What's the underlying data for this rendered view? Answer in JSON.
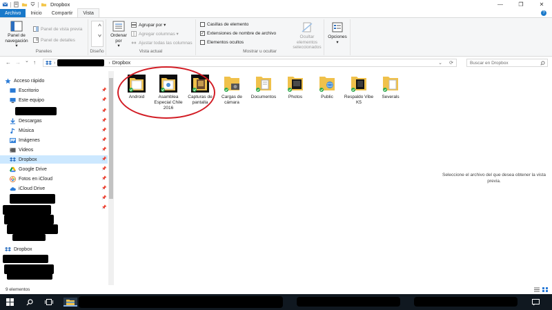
{
  "window": {
    "title": "Dropbox",
    "minimize": "—",
    "maximize": "❐",
    "close": "✕"
  },
  "tabs": [
    "Archivo",
    "Inicio",
    "Compartir",
    "Vista"
  ],
  "ribbon": {
    "help": "?",
    "paneles": {
      "label": "Paneles",
      "nav_pane": "Panel de navegación",
      "nav_pane_arrow": "▾",
      "preview_pane": "Panel de vista previa",
      "details_pane": "Panel de detalles"
    },
    "diseno": {
      "label": "Diseño"
    },
    "vista_actual": {
      "label": "Vista actual",
      "sort": "Ordenar por",
      "sort_arrow": "▾",
      "group": "Agrupar por ▾",
      "add_columns": "Agregar columnas ▾",
      "fit_columns": "Ajustar todas las columnas"
    },
    "mostrar": {
      "label": "Mostrar u ocultar",
      "item_checkboxes": "Casillas de elemento",
      "extensions": "Extensiones de nombre de archivo",
      "hidden_items": "Elementos ocultos",
      "hide_selected": "Ocultar elementos seleccionados",
      "check_mark": "✓"
    },
    "opciones": {
      "label": "Opciones",
      "arrow": "▾"
    }
  },
  "nav": {
    "back": "←",
    "forward": "→",
    "recent": "⌄",
    "up": "↑",
    "address": "Dropbox",
    "address_chevron": "›",
    "dropdown": "⌄",
    "refresh": "⟳",
    "search_placeholder": "Buscar en Dropbox"
  },
  "sidebar": {
    "pin": "📌",
    "items": [
      {
        "label": "Acceso rápido"
      },
      {
        "label": "Escritorio"
      },
      {
        "label": "Este equipo"
      },
      {
        "label": "Descargas"
      },
      {
        "label": "Música"
      },
      {
        "label": "Imágenes"
      },
      {
        "label": "Videos"
      },
      {
        "label": "Dropbox"
      },
      {
        "label": "Google Drive"
      },
      {
        "label": "Fotos en iCloud"
      },
      {
        "label": "iCloud Drive"
      },
      {
        "label": "Dropbox"
      }
    ]
  },
  "folders": [
    {
      "label": "Android"
    },
    {
      "label": "Asamblea Especial Chile 2016"
    },
    {
      "label": "Capturas de pantalla"
    },
    {
      "label": "Cargas de cámara"
    },
    {
      "label": "Documentos"
    },
    {
      "label": "Photos"
    },
    {
      "label": "Public"
    },
    {
      "label": "Respaldo Vibe K5"
    },
    {
      "label": "Severals"
    }
  ],
  "preview_message": "Seleccione el archivo del que desea obtener la vista previa.",
  "status": {
    "count": "9 elementos"
  },
  "colors": {
    "accent": "#1979ca",
    "selected": "#cce8ff",
    "annotation": "#d21c24",
    "taskbar": "#101820"
  }
}
